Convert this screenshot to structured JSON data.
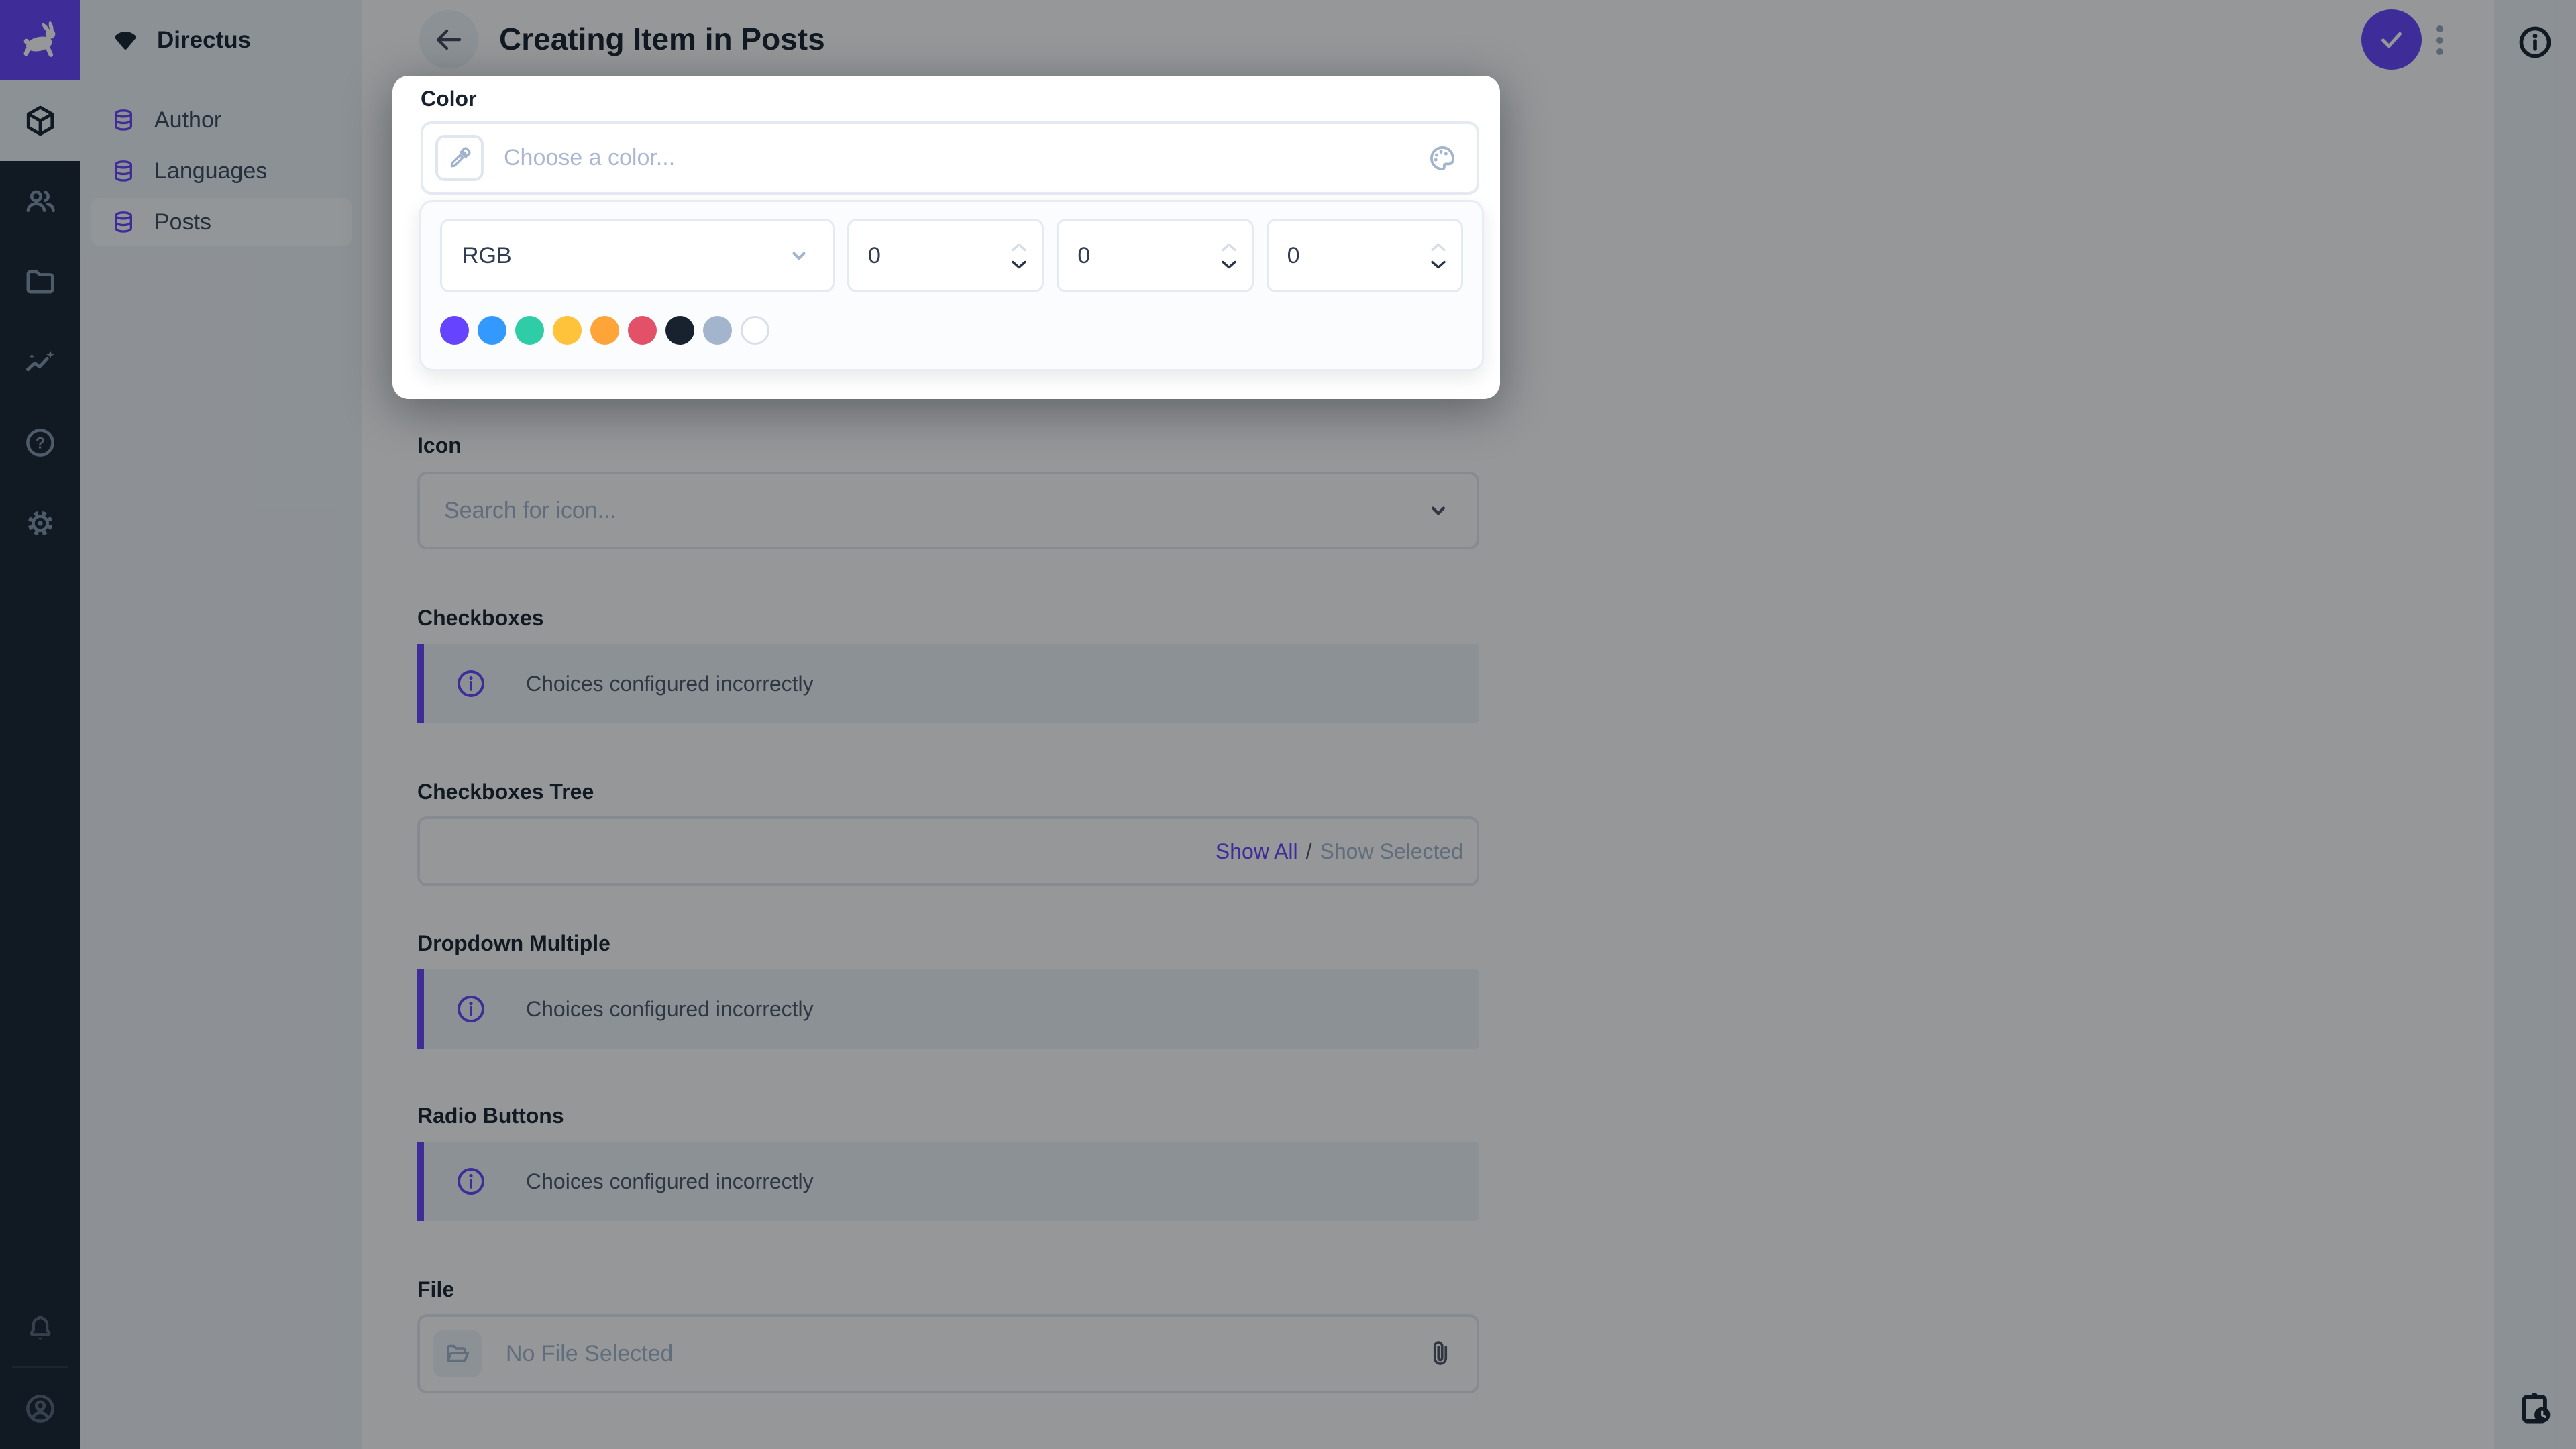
{
  "app": {
    "accent": "#6644FF",
    "module_bar_bg": "#18222F",
    "sidebar_bg": "#F0F4F9"
  },
  "project": {
    "name": "Directus"
  },
  "nav": {
    "items": [
      {
        "label": "Author"
      },
      {
        "label": "Languages"
      },
      {
        "label": "Posts"
      }
    ]
  },
  "header": {
    "title": "Creating Item in Posts"
  },
  "color_popup": {
    "label": "Color",
    "placeholder": "Choose a color...",
    "mode": "RGB",
    "r": "0",
    "g": "0",
    "b": "0",
    "swatches": [
      "#6644FF",
      "#3399FF",
      "#2ECDA7",
      "#FFC23B",
      "#FFA439",
      "#E35169",
      "#18222F",
      "#A2B5CD",
      "#FFFFFF"
    ]
  },
  "fields": {
    "icon": {
      "label": "Icon",
      "placeholder": "Search for icon..."
    },
    "checkboxes": {
      "label": "Checkboxes",
      "notice": "Choices configured incorrectly"
    },
    "checkboxes_tree": {
      "label": "Checkboxes Tree",
      "show_all": "Show All",
      "separator": "/",
      "show_selected": "Show Selected"
    },
    "dropdown_multiple": {
      "label": "Dropdown Multiple",
      "notice": "Choices configured incorrectly"
    },
    "radio_buttons": {
      "label": "Radio Buttons",
      "notice": "Choices configured incorrectly"
    },
    "file": {
      "label": "File",
      "placeholder": "No File Selected"
    }
  }
}
